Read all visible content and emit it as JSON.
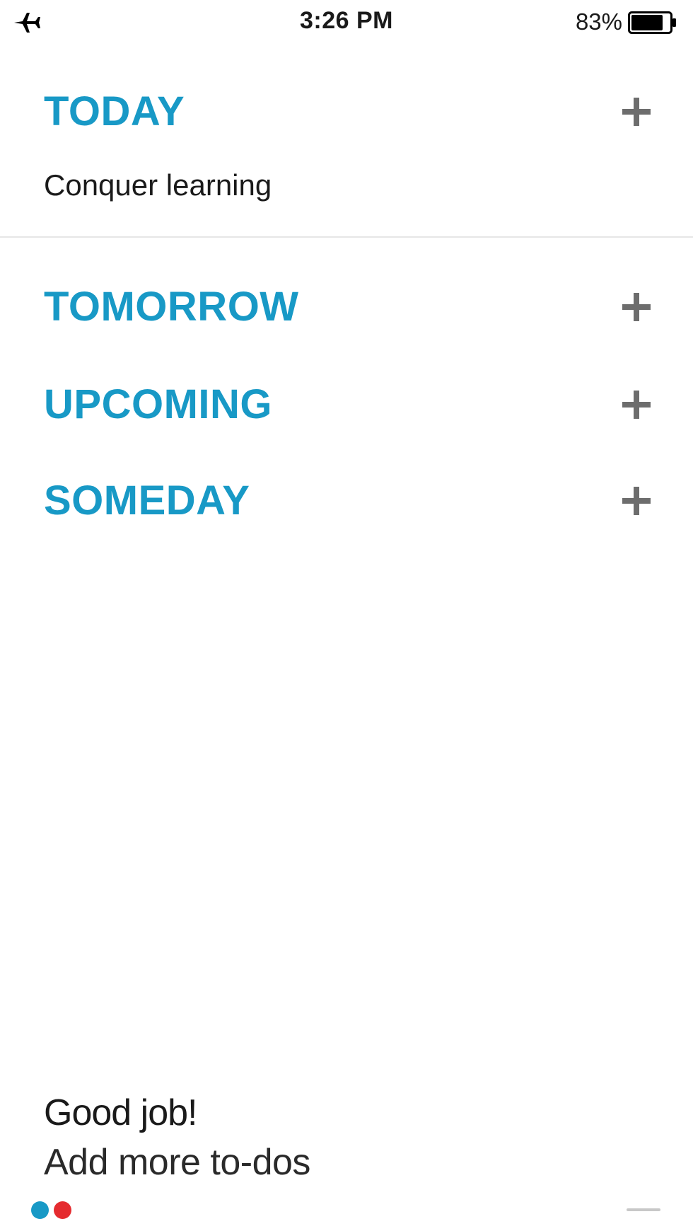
{
  "status_bar": {
    "airplane_icon": "airplane-icon",
    "time": "3:26 PM",
    "battery_percent": "83%",
    "battery_level": 0.83,
    "battery_icon": "battery-icon"
  },
  "sections": {
    "today": {
      "title": "TODAY",
      "add_icon": "plus-icon"
    },
    "tomorrow": {
      "title": "TOMORROW",
      "add_icon": "plus-icon"
    },
    "upcoming": {
      "title": "UPCOMING",
      "add_icon": "plus-icon"
    },
    "someday": {
      "title": "SOMEDAY",
      "add_icon": "plus-icon"
    }
  },
  "today_tasks": [
    {
      "label": "Conquer learning"
    }
  ],
  "message": {
    "title": "Good job!",
    "subtitle": "Add more to-dos"
  },
  "page_indicator": {
    "dot_colors": [
      "#1899c6",
      "#e52b2f"
    ]
  },
  "colors": {
    "accent": "#1899c6",
    "plus": "#6d6d6d",
    "text": "#1a1a1a"
  }
}
